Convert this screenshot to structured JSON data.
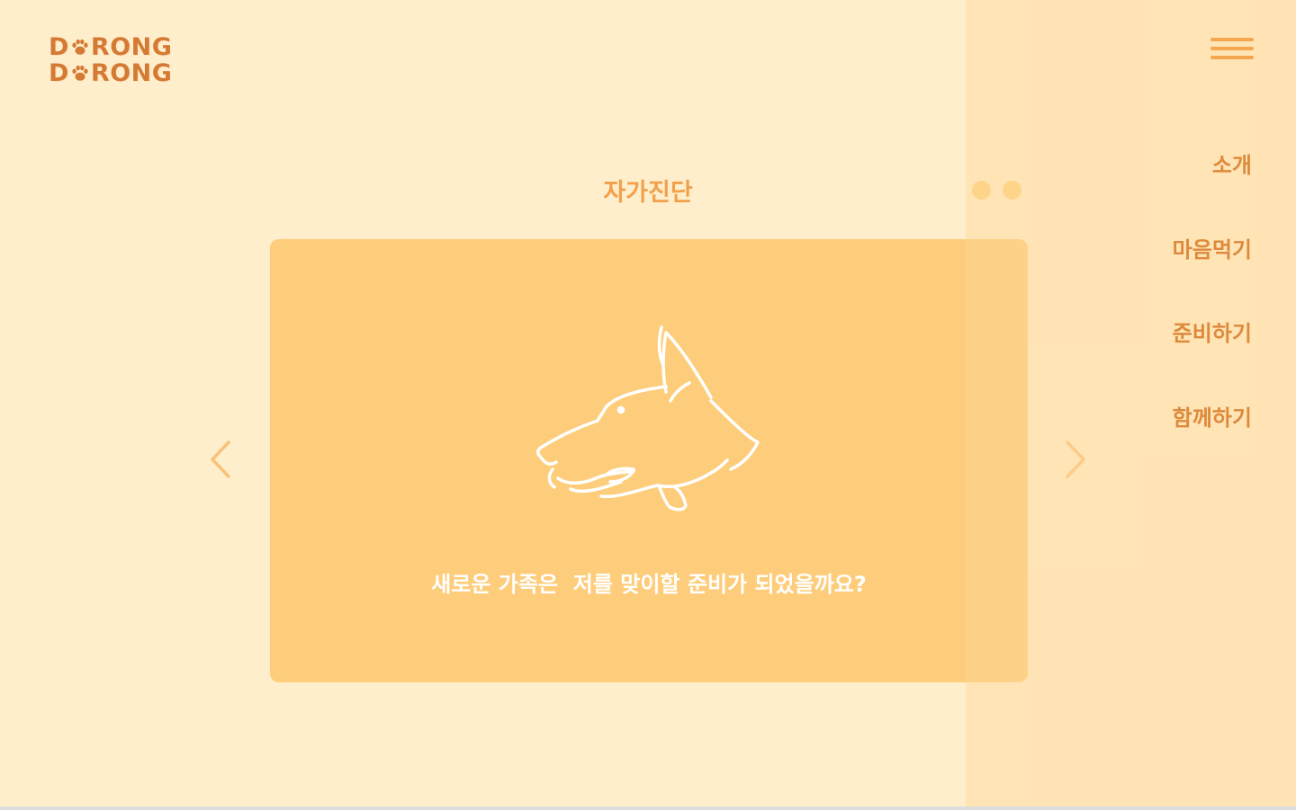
{
  "logo": {
    "line1_prefix": "D",
    "line1_suffix": "RONG",
    "line2_prefix": "D",
    "line2_suffix": "RONG",
    "icon": "paw-icon"
  },
  "section": {
    "title": "자가진단"
  },
  "card": {
    "text": "새로운 가족은  저를 맞이할 준비가 되었을까요?",
    "illustration": "dog-icon"
  },
  "nav": {
    "items": [
      {
        "label": "소개"
      },
      {
        "label": "마음먹기"
      },
      {
        "label": "준비하기"
      },
      {
        "label": "함께하기"
      }
    ]
  },
  "colors": {
    "background": "#ffeecb",
    "card": "#fecd7b",
    "accent": "#f2a04b",
    "nav_text": "#dd8a3c",
    "logo": "#d57a33"
  }
}
